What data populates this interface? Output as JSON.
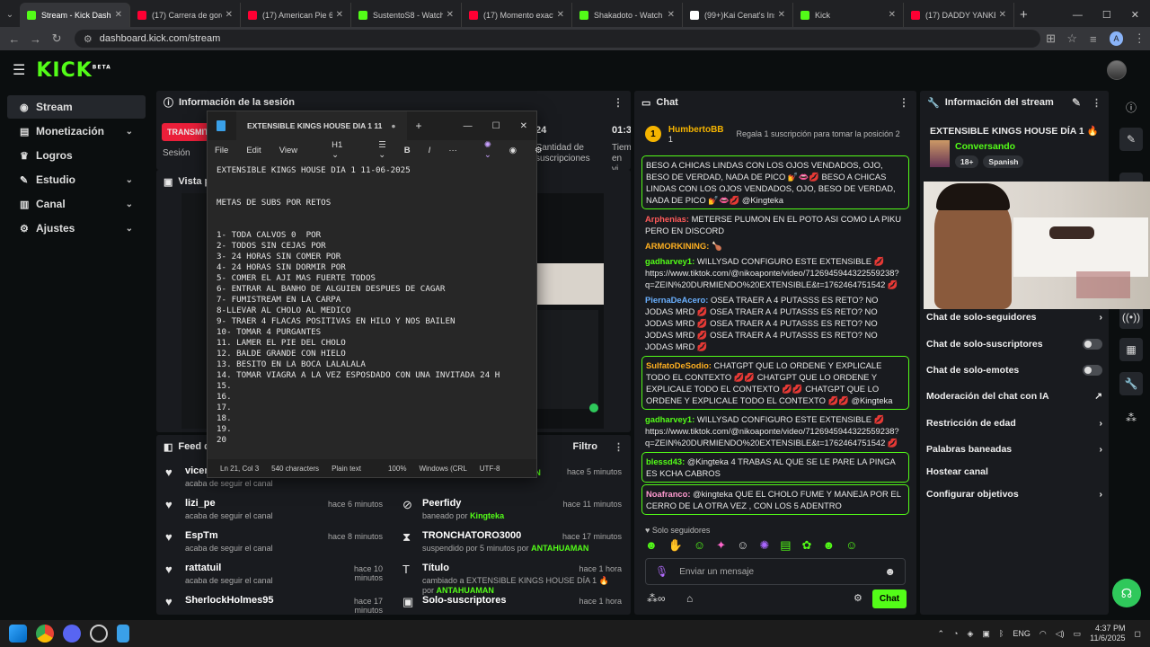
{
  "tabs": [
    {
      "label": "Stream - Kick Dashboa",
      "fav": "#53fc18",
      "active": true
    },
    {
      "label": "(17) Carrera de gordo",
      "fav": "#ff0033",
      "active": false
    },
    {
      "label": "(17) American Pie 6 -",
      "fav": "#ff0033",
      "active": false
    },
    {
      "label": "SustentoS8 - Watch c",
      "fav": "#53fc18",
      "active": false
    },
    {
      "label": "(17) Momento exacto",
      "fav": "#ff0033",
      "active": false
    },
    {
      "label": "Shakadoto - Watch c",
      "fav": "#53fc18",
      "active": false
    },
    {
      "label": "(99+)Kai Cenat's Insa",
      "fav": "#ffffff",
      "active": false
    },
    {
      "label": "Kick",
      "fav": "#53fc18",
      "active": false
    },
    {
      "label": "(17) DADDY YANKEE",
      "fav": "#ff0033",
      "active": false
    }
  ],
  "url": "dashboard.kick.com/stream",
  "logo": "KICK",
  "logo_badge": "BETA",
  "sidebar": [
    {
      "label": "Stream",
      "icon": "broadcast-icon",
      "glyph": "◉",
      "chev": ""
    },
    {
      "label": "Monetización",
      "icon": "money-icon",
      "glyph": "▤",
      "chev": "⌄"
    },
    {
      "label": "Logros",
      "icon": "trophy-icon",
      "glyph": "♛",
      "chev": ""
    },
    {
      "label": "Estudio",
      "icon": "studio-icon",
      "glyph": "✎",
      "chev": "⌄"
    },
    {
      "label": "Canal",
      "icon": "channel-icon",
      "glyph": "▥",
      "chev": "⌄"
    },
    {
      "label": "Ajustes",
      "icon": "gear-icon",
      "glyph": "⚙",
      "chev": "⌄"
    }
  ],
  "session": {
    "title": "Información de la sesión",
    "transmit": "TRANSMITIENDO",
    "session_label": "Sesión",
    "subs_value": "24",
    "subs_label": "Cantidad de suscripciones",
    "time_value": "01:3",
    "time_label": "Tiem en vi"
  },
  "preview": {
    "title": "Vista previa"
  },
  "feed": {
    "title": "Feed de actividad",
    "filter": "Filtro",
    "left": [
      {
        "name": "vicente",
        "sub": "acaba de seguir el canal",
        "time": ""
      },
      {
        "name": "lizi_pe",
        "sub": "acaba de seguir el canal",
        "time": "hace 6 minutos"
      },
      {
        "name": "EspTm",
        "sub": "acaba de seguir el canal",
        "time": "hace 8 minutos"
      },
      {
        "name": "rattatuil",
        "sub": "acaba de seguir el canal",
        "time": "hace 10 minutos"
      },
      {
        "name": "SherlockHolmes95",
        "sub": "",
        "time": "hace 17 minutos"
      }
    ],
    "right": [
      {
        "name": "",
        "sub": "desbaneado por",
        "by": "ANTAHUAMAN",
        "time": "hace 5 minutos"
      },
      {
        "name": "Peerfidy",
        "sub": "baneado por",
        "by": "Kingteka",
        "time": "hace 11 minutos"
      },
      {
        "name": "TRONCHATORO3000",
        "sub": "suspendido por 5 minutos por",
        "by": "ANTAHUAMAN",
        "time": "hace 17 minutos"
      },
      {
        "name": "Título",
        "sub": "cambiado a EXTENSIBLE KINGS HOUSE DÍA 1 🔥 por",
        "by": "ANTAHUAMAN",
        "time": "hace 1 hora"
      },
      {
        "name": "Solo-suscriptores",
        "sub": "",
        "by": "",
        "time": "hace 1 hora"
      }
    ]
  },
  "chat": {
    "title": "Chat",
    "gift_user": "HumbertoBB",
    "gift_count": "1",
    "gift_text": "Regala 1 suscripción para tomar la posición 2",
    "messages": [
      {
        "user": "",
        "color": "#ffffff",
        "text": "BESO A CHICAS LINDAS CON LOS OJOS VENDADOS, OJO, BESO DE VERDAD, NADA DE PICO 💅👄💋 BESO A CHICAS LINDAS CON LOS OJOS VENDADOS, OJO, BESO DE VERDAD, NADA DE PICO 💅👄💋 @Kingteka",
        "hl": true
      },
      {
        "user": "Arphenias:",
        "color": "#ff5a5a",
        "text": "METERSE PLUMON EN EL POTO ASI COMO LA PIKU PERO EN DISCORD",
        "hl": false
      },
      {
        "user": "ARMORKINING:",
        "color": "#ffb020",
        "text": "🍗",
        "hl": false
      },
      {
        "user": "gadharvey1:",
        "color": "#53fc18",
        "text": "WILLYSAD CONFIGURO ESTE EXTENSIBLE 💋 https://www.tiktok.com/@nikoaponte/video/7126945944322559238?q=ZEIN%20DURMIENDO%20EXTENSIBLE&t=1762464751542 💋",
        "hl": false
      },
      {
        "user": "PiernaDeAcero:",
        "color": "#6ab0ff",
        "text": "OSEA TRAER A 4 PUTASSS ES RETO? NO JODAS MRD 💋 OSEA TRAER A 4 PUTASSS ES RETO? NO JODAS MRD 💋 OSEA TRAER A 4 PUTASSS ES RETO? NO JODAS MRD 💋 OSEA TRAER A 4 PUTASSS ES RETO? NO JODAS MRD 💋",
        "hl": false
      },
      {
        "user": "SulfatoDeSodio:",
        "color": "#ffb020",
        "text": "CHATGPT QUE LO ORDENE Y EXPLICALE TODO EL CONTEXTO 💋💋 CHATGPT QUE LO ORDENE Y EXPLICALE TODO EL CONTEXTO 💋💋 CHATGPT QUE LO ORDENE Y EXPLICALE TODO EL CONTEXTO 💋💋 @Kingteka",
        "hl": true
      },
      {
        "user": "gadharvey1:",
        "color": "#53fc18",
        "text": "WILLYSAD CONFIGURO ESTE EXTENSIBLE 💋 https://www.tiktok.com/@nikoaponte/video/7126945944322559238?q=ZEIN%20DURMIENDO%20EXTENSIBLE&t=1762464751542 💋",
        "hl": false
      },
      {
        "user": "blessd43:",
        "color": "#53fc18",
        "text": "@Kingteka 4 TRABAS AL QUE SE LE PARE LA PINGA ES KCHA CABROS",
        "hl": true
      },
      {
        "user": "Noafranco:",
        "color": "#ff9ad0",
        "text": "@kingteka QUE EL CHOLO FUME Y MANEJA POR EL CERRO DE LA OTRA VEZ , CON LOS 5 ADENTRO",
        "hl": true
      }
    ],
    "followers_only": "Solo seguidores",
    "input_placeholder": "Enviar un mensaje",
    "send": "Chat"
  },
  "stream_info": {
    "title": "Información del stream",
    "stream_title": "EXTENSIBLE KINGS HOUSE DÍA 1 🔥",
    "category": "Conversando",
    "tags": [
      "18+",
      "Spanish"
    ],
    "options": [
      {
        "label": "Chat de solo-seguidores",
        "kind": "chev"
      },
      {
        "label": "Chat de solo-suscriptores",
        "kind": "toggle"
      },
      {
        "label": "Chat de solo-emotes",
        "kind": "toggle"
      },
      {
        "label": "Moderación del chat con IA",
        "kind": "ext"
      },
      {
        "label": "Restricción de edad",
        "kind": "chev"
      },
      {
        "label": "Palabras baneadas",
        "kind": "chev"
      },
      {
        "label": "Hostear canal",
        "kind": "none"
      },
      {
        "label": "Configurar objetivos",
        "kind": "chev"
      }
    ]
  },
  "notepad": {
    "tab_title": "EXTENSIBLE KINGS HOUSE DIA 1 11",
    "menu": [
      "File",
      "Edit",
      "View"
    ],
    "heading": "H1",
    "content": "EXTENSIBLE KINGS HOUSE DIA 1 11-06-2025\n\n\nMETAS DE SUBS POR RETOS\n\n\n1- TODA CALVOS 0  POR\n2- TODOS SIN CEJAS POR\n3- 24 HORAS SIN COMER POR\n4- 24 HORAS SIN DORMIR POR\n5- COMER EL AJI MAS FUERTE TODOS\n6- ENTRAR AL BANHO DE ALGUIEN DESPUES DE CAGAR\n7- FUMISTREAM EN LA CARPA\n8-LLEVAR AL CHOLO AL MEDICO\n9- TRAER 4 FLACAS POSITIVAS EN HILO Y NOS BAILEN\n10- TOMAR 4 PURGANTES\n11. LAMER EL PIE DEL CHOLO\n12. BALDE GRANDE CON HIELO\n13. BESITO EN LA BOCA LALALALA\n14. TOMAR VIAGRA A LA VEZ ESPOSDADO CON UNA INVITADA 24 H\n15.\n16.\n17.\n18.\n19.\n20",
    "status": [
      "Ln 21, Col 3",
      "540 characters",
      "Plain text",
      "100%",
      "Windows (CRL",
      "UTF-8"
    ]
  },
  "taskbar": {
    "lang": "ENG",
    "time": "4:37 PM",
    "date": "11/6/2025"
  }
}
